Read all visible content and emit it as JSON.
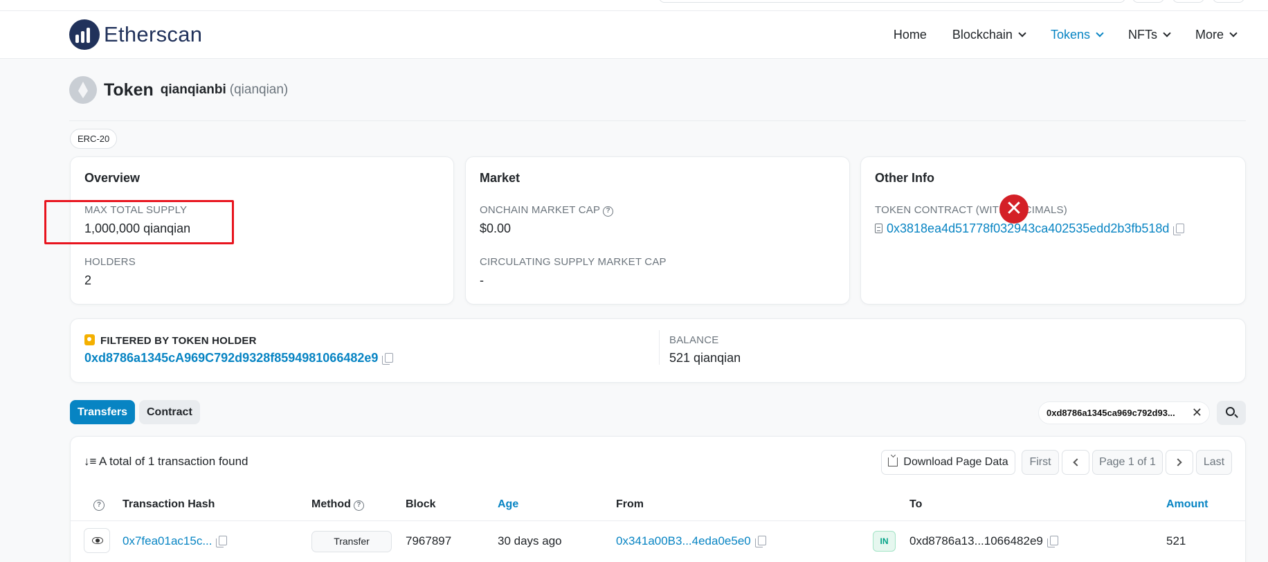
{
  "header": {
    "brand": "Etherscan",
    "nav": [
      {
        "label": "Home",
        "dropdown": false,
        "active": false
      },
      {
        "label": "Blockchain",
        "dropdown": true,
        "active": false
      },
      {
        "label": "Tokens",
        "dropdown": true,
        "active": true
      },
      {
        "label": "NFTs",
        "dropdown": true,
        "active": false
      },
      {
        "label": "More",
        "dropdown": true,
        "active": false
      }
    ]
  },
  "token": {
    "title_word": "Token",
    "name": "qianqianbi",
    "symbol": "(qianqian)",
    "standard_badge": "ERC-20"
  },
  "overview": {
    "title": "Overview",
    "max_supply_label": "MAX TOTAL SUPPLY",
    "max_supply_value": "1,000,000 qianqian",
    "holders_label": "HOLDERS",
    "holders_value": "2"
  },
  "market": {
    "title": "Market",
    "onchain_cap_label": "ONCHAIN MARKET CAP",
    "onchain_cap_value": "$0.00",
    "circ_cap_label": "CIRCULATING SUPPLY MARKET CAP",
    "circ_cap_value": "-"
  },
  "other_info": {
    "title": "Other Info",
    "contract_label": "TOKEN CONTRACT (WITH DECIMALS)",
    "contract_address": "0x3818ea4d51778f032943ca402535edd2b3fb518d"
  },
  "filter": {
    "label": "FILTERED BY TOKEN HOLDER",
    "holder_address": "0xd8786a1345cA969C792d9328f8594981066482e9",
    "balance_label": "BALANCE",
    "balance_value": "521 qianqian"
  },
  "tabs": [
    {
      "label": "Transfers",
      "active": true
    },
    {
      "label": "Contract",
      "active": false
    }
  ],
  "search_filter": {
    "value": "0xd8786a1345ca969c792d93..."
  },
  "transactions": {
    "summary": "A total of 1 transaction found",
    "download_label": "Download Page Data",
    "pagination": {
      "first": "First",
      "page": "Page 1 of 1",
      "last": "Last"
    },
    "columns": [
      "Transaction Hash",
      "Method",
      "Block",
      "Age",
      "From",
      "To",
      "Amount"
    ],
    "rows": [
      {
        "hash": "0x7fea01ac15c...",
        "method": "Transfer",
        "block": "7967897",
        "age": "30 days ago",
        "from": "0x341a00B3...4eda0e5e0",
        "direction": "IN",
        "to": "0xd8786a13...1066482e9",
        "amount": "521"
      }
    ]
  },
  "colors": {
    "accent": "#0784c3",
    "brand_navy": "#21325b",
    "highlight_red": "#e8141e",
    "in_green": "#00a186"
  },
  "icons": [
    "ethereum-token-icon",
    "help-circle-icon",
    "copy-icon",
    "document-icon",
    "filter-holder-icon",
    "sort-icon",
    "download-icon",
    "eye-icon",
    "search-icon",
    "close-icon",
    "chevron-down-icon"
  ]
}
